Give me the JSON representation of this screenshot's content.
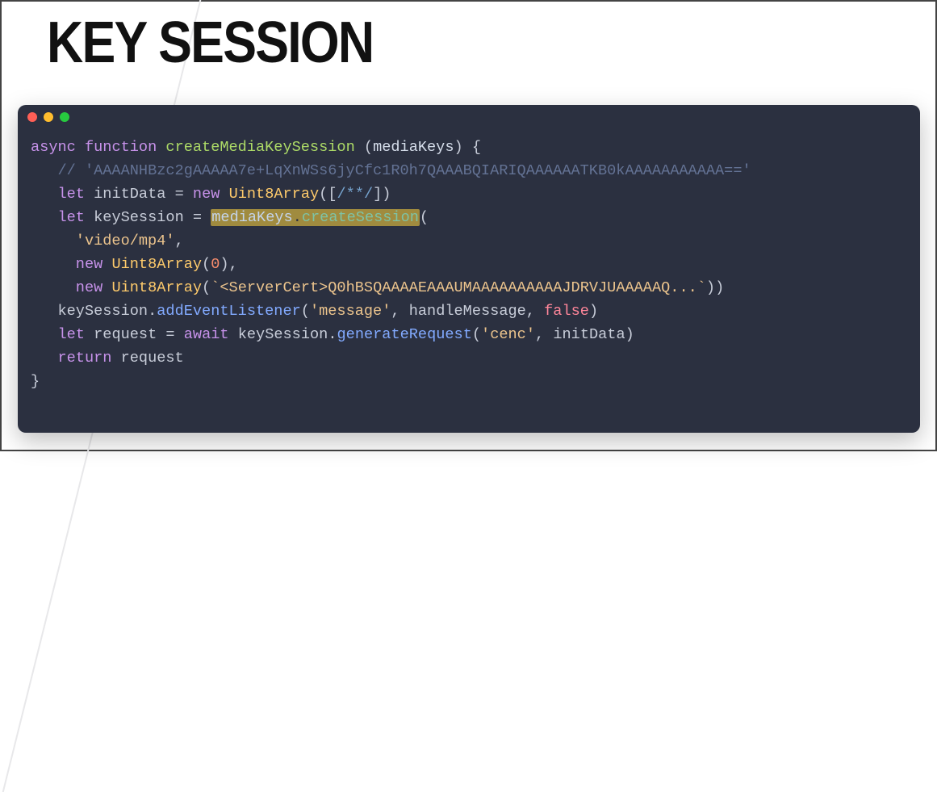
{
  "title": "KEY SESSION",
  "window": {
    "dots": [
      "red",
      "yellow",
      "green"
    ]
  },
  "code": {
    "kw_async": "async",
    "kw_function": "function",
    "fn_name": "createMediaKeySession",
    "param": "mediaKeys",
    "brace_open": "{",
    "brace_close": "}",
    "comment": "// 'AAAANHBzc2gAAAAA7e+LqXnWSs6jyCfc1R0h7QAAABQIARIQAAAAAATKB0kAAAAAAAAAAA=='",
    "kw_let1": "let",
    "var_initData": "initData",
    "eq": "=",
    "kw_new1": "new",
    "cls_u8_1": "Uint8Array",
    "br_open": "([",
    "inline_cmt": "/**/",
    "br_close": "])",
    "kw_let2": "let",
    "var_keySession": "keySession",
    "hl_obj": "mediaKeys",
    "hl_dot": ".",
    "hl_meth": "createSession",
    "paren_open": "(",
    "str_videomp4": "'video/mp4'",
    "comma": ",",
    "kw_new2": "new",
    "cls_u8_2": "Uint8Array",
    "num_zero": "0",
    "kw_new3": "new",
    "cls_u8_3": "Uint8Array",
    "str_cert": "`<ServerCert>Q0hBSQAAAAEAAAUMAAAAAAAAAAJDRVJUAAAAAQ...`",
    "paren_close2": "))",
    "obj_keySession": "keySession",
    "dot": ".",
    "fn_add": "addEventListener",
    "str_message": "'message'",
    "id_handle": "handleMessage",
    "bool_false": "false",
    "paren_close": ")",
    "kw_let3": "let",
    "var_request": "request",
    "kw_await": "await",
    "obj_keySession2": "keySession",
    "fn_gen": "generateRequest",
    "str_cenc": "'cenc'",
    "id_initData": "initData",
    "kw_return": "return",
    "ret_val": "request"
  }
}
